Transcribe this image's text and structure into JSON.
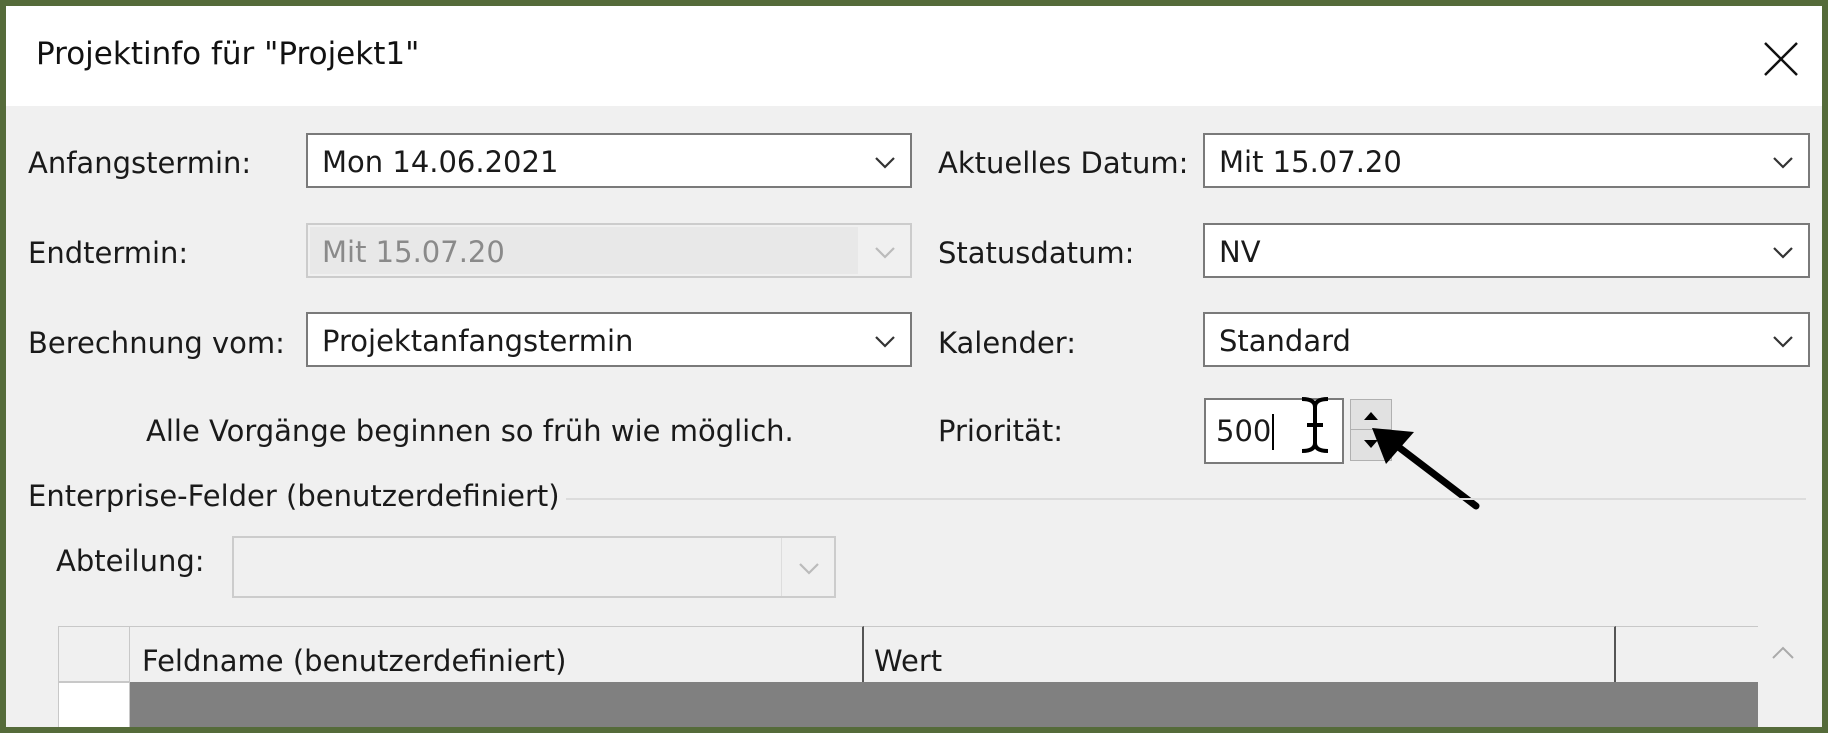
{
  "window": {
    "title": "Projektinfo für \"Projekt1\"",
    "close_icon": "close-icon"
  },
  "fields": {
    "start_date": {
      "label": "Anfangstermin:",
      "value": "Mon 14.06.2021"
    },
    "end_date": {
      "label": "Endtermin:",
      "value": "Mit 15.07.20"
    },
    "schedule_from": {
      "label": "Berechnung vom:",
      "value": "Projektanfangstermin"
    },
    "schedule_note": "Alle Vorgänge beginnen so früh wie möglich.",
    "current_date": {
      "label": "Aktuelles Datum:",
      "value": "Mit 15.07.20"
    },
    "status_date": {
      "label": "Statusdatum:",
      "value": "NV"
    },
    "calendar": {
      "label": "Kalender:",
      "value": "Standard"
    },
    "priority": {
      "label": "Priorität:",
      "value": "500"
    }
  },
  "enterprise": {
    "heading": "Enterprise-Felder (benutzerdefiniert)",
    "department_label": "Abteilung:",
    "department_value": ""
  },
  "grid": {
    "columns": [
      "",
      "Feldname (benutzerdefiniert)",
      "Wert",
      ""
    ]
  },
  "colors": {
    "frame": "#556b3a",
    "dialog_bg": "#f0f0f0",
    "selected_row": "#808080"
  }
}
